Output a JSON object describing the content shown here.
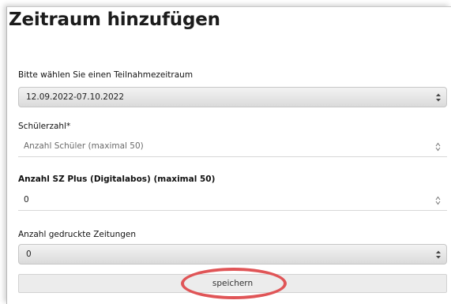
{
  "page": {
    "title": "Zeitraum hinzufügen"
  },
  "period": {
    "label": "Bitte wählen Sie einen Teilnahmezeitraum",
    "value": "12.09.2022-07.10.2022"
  },
  "students": {
    "label": "Schülerzahl*",
    "placeholder": "Anzahl Schüler (maximal 50)"
  },
  "sz_plus": {
    "label": "Anzahl SZ Plus (Digitalabos) (maximal 50)",
    "value": "0"
  },
  "printed": {
    "label": "Anzahl gedruckte Zeitungen",
    "value": "0"
  },
  "actions": {
    "save_label": "speichern"
  },
  "colors": {
    "highlight": "#e05557"
  }
}
